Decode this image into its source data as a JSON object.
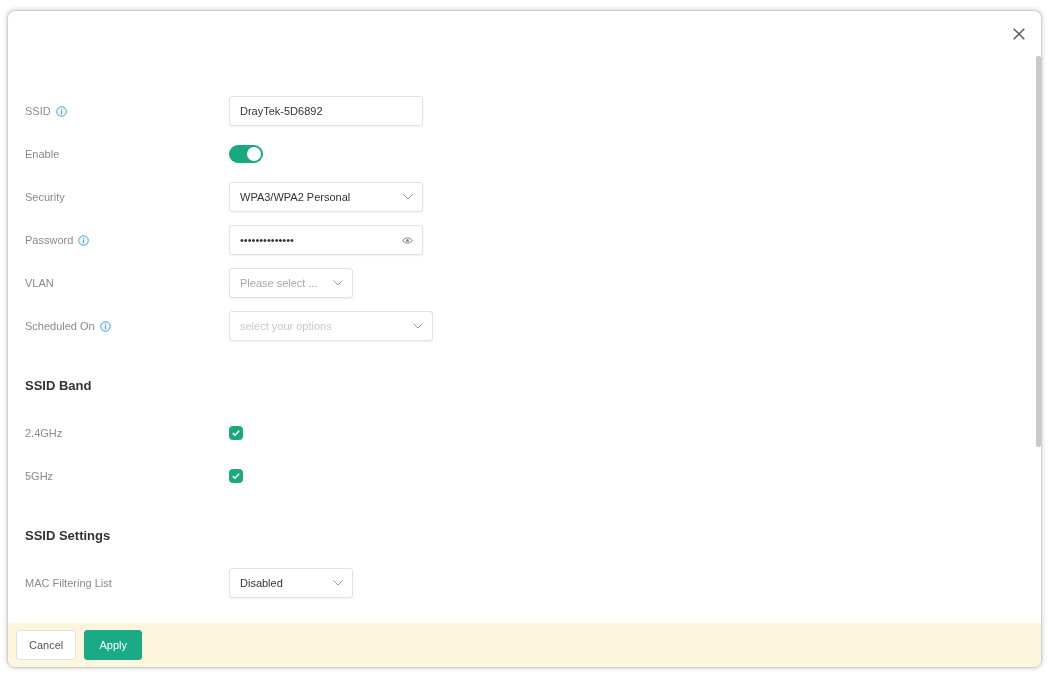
{
  "dialog": {
    "sections": [
      {
        "fields": [
          {
            "kind": "text",
            "label": "SSID",
            "info": true,
            "value": "DrayTek-5D6892"
          },
          {
            "kind": "toggle",
            "label": "Enable",
            "info": false,
            "on": true
          },
          {
            "kind": "select",
            "label": "Security",
            "info": false,
            "value": "WPA3/WPA2 Personal"
          },
          {
            "kind": "password",
            "label": "Password",
            "info": true,
            "value": "••••••••••••••"
          },
          {
            "kind": "dropdown",
            "label": "VLAN",
            "info": false,
            "placeholder": "Please select ..."
          },
          {
            "kind": "multiselect",
            "label": "Scheduled On",
            "info": true,
            "placeholder": "select your options"
          }
        ]
      },
      {
        "title": "SSID Band",
        "fields": [
          {
            "kind": "checkbox",
            "label": "2.4GHz",
            "info": false,
            "checked": true
          },
          {
            "kind": "checkbox",
            "label": "5GHz",
            "info": false,
            "checked": true
          }
        ]
      },
      {
        "title": "SSID Settings",
        "fields": [
          {
            "kind": "dropdown",
            "label": "MAC Filtering List",
            "info": false,
            "value": "Disabled"
          }
        ]
      }
    ],
    "footer": {
      "buttons": [
        {
          "label": "Cancel",
          "kind": "secondary"
        },
        {
          "label": "Apply",
          "kind": "primary"
        }
      ]
    }
  }
}
